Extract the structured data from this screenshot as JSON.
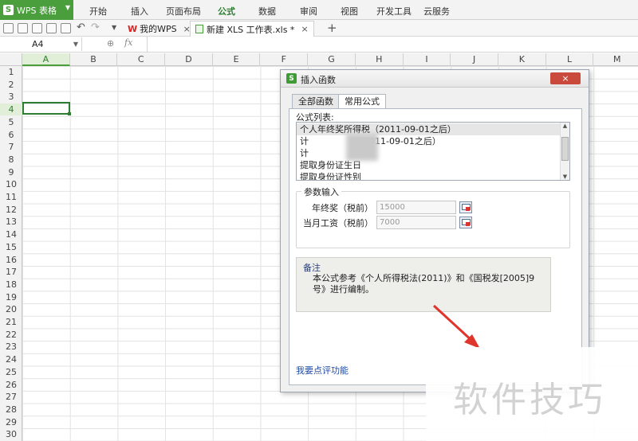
{
  "app": {
    "name": "WPS 表格"
  },
  "menu": [
    "开始",
    "插入",
    "页面布局",
    "公式",
    "数据",
    "审阅",
    "视图",
    "开发工具",
    "云服务"
  ],
  "menu_active_index": 3,
  "tabs": {
    "home_label": "我的WPS",
    "file_label": "新建 XLS 工作表.xls *",
    "add_symbol": "+",
    "close_symbol": "×"
  },
  "formula_bar": {
    "name_box": "A4",
    "fx_label": "fx",
    "value": ""
  },
  "grid": {
    "columns": [
      "A",
      "B",
      "C",
      "D",
      "E",
      "F",
      "G",
      "H",
      "I",
      "J",
      "K",
      "L",
      "M"
    ],
    "rows": [
      "1",
      "2",
      "3",
      "4",
      "5",
      "6",
      "7",
      "8",
      "9",
      "10",
      "11",
      "12",
      "13",
      "14",
      "15",
      "16",
      "17",
      "18",
      "19",
      "20",
      "21",
      "22",
      "23",
      "24",
      "25",
      "26",
      "27",
      "28",
      "29",
      "30"
    ],
    "selected_cell": "A4"
  },
  "dialog": {
    "title": "插入函数",
    "close_symbol": "×",
    "tabs": [
      "全部函数",
      "常用公式"
    ],
    "active_tab": 1,
    "formula_list_label": "公式列表:",
    "formula_list": [
      "个人年终奖所得税（2011-09-01之后）",
      "计",
      "计",
      "提取身份证生日",
      "提取身份证性别"
    ],
    "formula_list_tails": [
      "",
      "2011-09-01之后）",
      "..."
    ],
    "params_title": "参数输入",
    "params": [
      {
        "label": "年终奖（税前）",
        "value": "15000"
      },
      {
        "label": "当月工资（税前）",
        "value": "7000"
      }
    ],
    "note_title": "备注",
    "note_text": "本公式参考《个人所得税法(2011)》和《国税发[2005]9号》进行编制。",
    "feedback_link": "我要点评功能"
  },
  "watermark": "软件技巧",
  "colors": {
    "accent": "#4a9e3c",
    "close_red": "#c94a3c",
    "link": "#1f4aa8",
    "arrow": "#e0352b"
  }
}
